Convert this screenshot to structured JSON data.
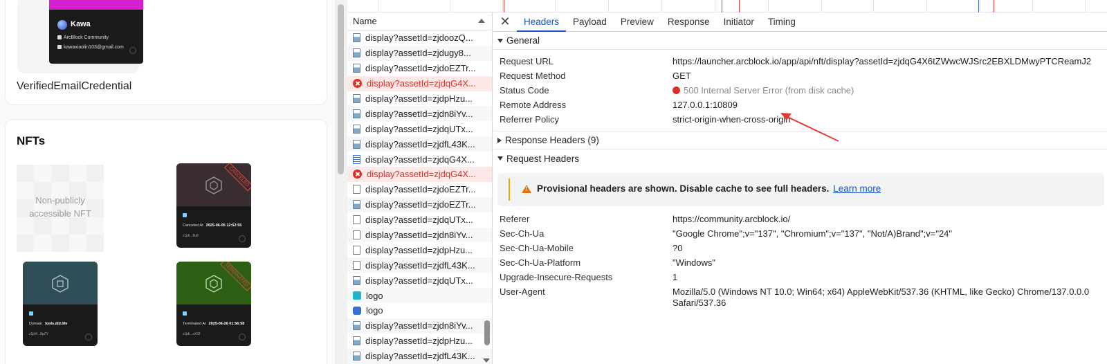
{
  "left_page": {
    "credential": {
      "holder_name": "Kawa",
      "community": "ArcBlock Community",
      "email": "kawaxiaolin103@gmail.com",
      "title": "VerifiedEmailCredential"
    },
    "nfts": {
      "title": "NFTs",
      "private_label": "Non-publicly accessible NFT",
      "items": [
        {
          "stamp": "CANCELED",
          "meta_label": "Canceled At",
          "meta_value": "2025-06-05 12:52:55",
          "owner": "z1jdi...8u8",
          "color": "#3a2d31"
        },
        {
          "stamp": "",
          "meta_label": "Domain",
          "meta_value": "tools.did.life",
          "owner": "z1jd4...8pZY",
          "color": "#2f4e58"
        },
        {
          "stamp": "TERMINATED",
          "meta_label": "Terminated At",
          "meta_value": "2025-06-26 01:56:58",
          "owner": "z1jdi...vXSf",
          "color": "#2c5e14"
        }
      ]
    }
  },
  "devtools": {
    "name_column": "Name",
    "requests": [
      {
        "name": "display?assetId=zjdoozQ...",
        "icon": "img",
        "error": false
      },
      {
        "name": "display?assetId=zjdugy8...",
        "icon": "img",
        "error": false
      },
      {
        "name": "display?assetId=zjdoEZTr...",
        "icon": "img",
        "error": false
      },
      {
        "name": "display?assetId=zjdqG4X...",
        "icon": "err",
        "error": true
      },
      {
        "name": "display?assetId=zjdpHzu...",
        "icon": "img",
        "error": false
      },
      {
        "name": "display?assetId=zjdn8iYv...",
        "icon": "img",
        "error": false
      },
      {
        "name": "display?assetId=zjdqUTx...",
        "icon": "img",
        "error": false
      },
      {
        "name": "display?assetId=zjdfL43K...",
        "icon": "img",
        "error": false
      },
      {
        "name": "display?assetId=zjdqG4X...",
        "icon": "list",
        "error": false
      },
      {
        "name": "display?assetId=zjdqG4X...",
        "icon": "err",
        "error": true
      },
      {
        "name": "display?assetId=zjdoEZTr...",
        "icon": "doc",
        "error": false
      },
      {
        "name": "display?assetId=zjdoEZTr...",
        "icon": "img",
        "error": false
      },
      {
        "name": "display?assetId=zjdqUTx...",
        "icon": "doc",
        "error": false
      },
      {
        "name": "display?assetId=zjdn8iYv...",
        "icon": "doc",
        "error": false
      },
      {
        "name": "display?assetId=zjdpHzu...",
        "icon": "doc",
        "error": false
      },
      {
        "name": "display?assetId=zjdfL43K...",
        "icon": "doc",
        "error": false
      },
      {
        "name": "display?assetId=zjdqUTx...",
        "icon": "img",
        "error": false
      },
      {
        "name": "logo",
        "icon": "logo1",
        "error": false
      },
      {
        "name": "logo",
        "icon": "logo2",
        "error": false
      },
      {
        "name": "display?assetId=zjdn8iYv...",
        "icon": "img",
        "error": false
      },
      {
        "name": "display?assetId=zjdpHzu...",
        "icon": "img",
        "error": false
      },
      {
        "name": "display?assetId=zjdfL43K...",
        "icon": "img",
        "error": false
      }
    ],
    "tabs": [
      "Headers",
      "Payload",
      "Preview",
      "Response",
      "Initiator",
      "Timing"
    ],
    "active_tab": "Headers",
    "general": {
      "title": "General",
      "rows": [
        {
          "key": "Request URL",
          "value": "https://launcher.arcblock.io/app/api/nft/display?assetId=zjdqG4X6tZWwcWJSrc2EBXLDMwyPTCReamJ2"
        },
        {
          "key": "Request Method",
          "value": "GET"
        },
        {
          "key": "Status Code",
          "value": "500 Internal Server Error (from disk cache)"
        },
        {
          "key": "Remote Address",
          "value": "127.0.0.1:10809"
        },
        {
          "key": "Referrer Policy",
          "value": "strict-origin-when-cross-origin"
        }
      ]
    },
    "response_headers": {
      "title": "Response Headers (9)"
    },
    "request_headers": {
      "title": "Request Headers",
      "warning": "Provisional headers are shown. Disable cache to see full headers.",
      "learn_more": "Learn more",
      "rows": [
        {
          "key": "Referer",
          "value": "https://community.arcblock.io/"
        },
        {
          "key": "Sec-Ch-Ua",
          "value": "\"Google Chrome\";v=\"137\", \"Chromium\";v=\"137\", \"Not/A)Brand\";v=\"24\""
        },
        {
          "key": "Sec-Ch-Ua-Mobile",
          "value": "?0"
        },
        {
          "key": "Sec-Ch-Ua-Platform",
          "value": "\"Windows\""
        },
        {
          "key": "Upgrade-Insecure-Requests",
          "value": "1"
        },
        {
          "key": "User-Agent",
          "value": "Mozilla/5.0 (Windows NT 10.0; Win64; x64) AppleWebKit/537.36 (KHTML, like Gecko) Chrome/137.0.0.0 Safari/537.36"
        }
      ]
    },
    "colors": {
      "accent": "#1a56c9",
      "error": "#d93025",
      "warning": "#e8710a",
      "annotation": "#e53935"
    }
  }
}
